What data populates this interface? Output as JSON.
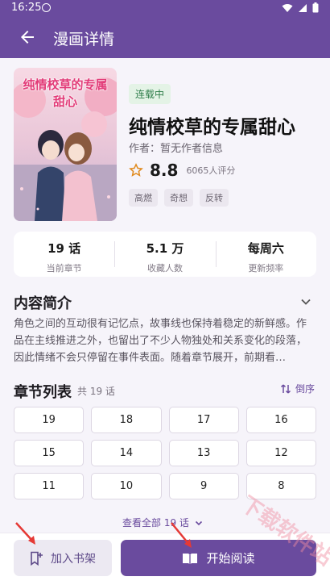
{
  "status_bar": {
    "time": "16:25"
  },
  "app_bar": {
    "title": "漫画详情"
  },
  "comic": {
    "cover_title": "纯情校草的专属甜心",
    "status_badge": "连载中",
    "title": "纯情校草的专属甜心",
    "author": "作者：暂无作者信息",
    "rating": "8.8",
    "rating_count": "6065人评分",
    "tags": [
      "高燃",
      "奇想",
      "反转"
    ]
  },
  "stats": [
    {
      "value": "19 话",
      "label": "当前章节"
    },
    {
      "value": "5.1 万",
      "label": "收藏人数"
    },
    {
      "value": "每周六",
      "label": "更新频率"
    }
  ],
  "intro": {
    "heading": "内容简介",
    "text": "角色之间的互动很有记忆点，故事线也保持着稳定的新鲜感。作品在主线推进之外，也留出了不少人物独处和关系变化的段落，因此情绪不会只停留在事件表面。随着章节展开，前期看…"
  },
  "chapters": {
    "heading": "章节列表",
    "count": "共 19 话",
    "sort_label": "倒序",
    "items": [
      "19",
      "18",
      "17",
      "16",
      "15",
      "14",
      "13",
      "12",
      "11",
      "10",
      "9",
      "8"
    ],
    "view_all": "查看全部 19 话"
  },
  "bottom": {
    "add_shelf": "加入书架",
    "start_read": "开始阅读"
  },
  "watermark": "下载软件站",
  "colors": {
    "primary": "#6a4b9e",
    "badge_bg": "#e4f3e6",
    "badge_text": "#2e7d4a",
    "annotation_red": "#e53935",
    "star": "#e08a1e"
  }
}
